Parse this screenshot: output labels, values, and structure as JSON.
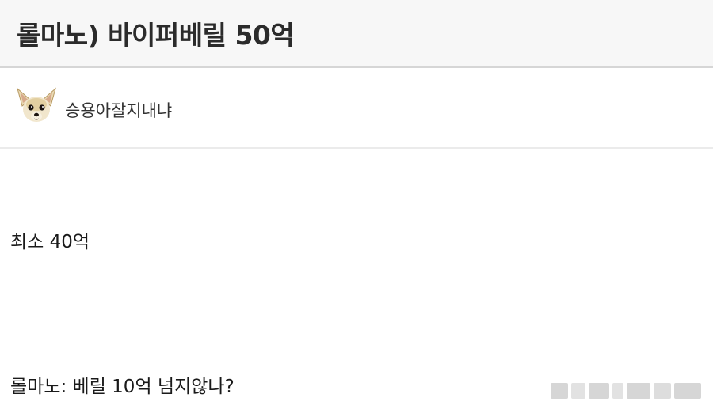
{
  "post": {
    "title": "롤마노) 바이퍼베릴 50억",
    "author": {
      "name": "승용아잘지내냐",
      "avatar_icon": "chihuahua-avatar-icon"
    },
    "body_lines": [
      "최소 40억",
      "롤마노: 베릴 10억 넘지않나?"
    ]
  },
  "watermark": {
    "icon": "blurred-watermark",
    "color": "#cfcfcf"
  }
}
